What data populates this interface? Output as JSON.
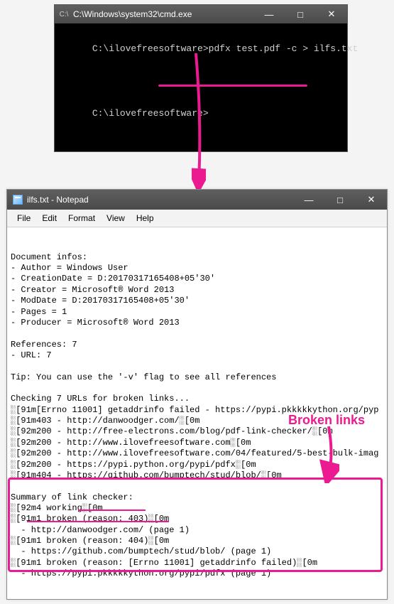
{
  "cmd": {
    "title": "C:\\Windows\\system32\\cmd.exe",
    "prompt1": "C:\\ilovefreesoftware>",
    "command": "pdfx test.pdf -c > ilfs.txt",
    "prompt2": "C:\\ilovefreesoftware>"
  },
  "notepad": {
    "title": "ilfs.txt - Notepad",
    "menu": [
      "File",
      "Edit",
      "Format",
      "View",
      "Help"
    ],
    "lines": [
      "Document infos:",
      "- Author = Windows User",
      "- CreationDate = D:20170317165408+05'30'",
      "- Creator = Microsoft® Word 2013",
      "- ModDate = D:20170317165408+05'30'",
      "- Pages = 1",
      "- Producer = Microsoft® Word 2013",
      "",
      "References: 7",
      "- URL: 7",
      "",
      "Tip: You can use the '-v' flag to see all references",
      "",
      "Checking 7 URLs for broken links...",
      "░[91m[Errno 11001] getaddrinfo failed - https://pypi.pkkkkkython.org/pyp",
      "░[91m403 - http://danwoodger.com/░[0m",
      "░[92m200 - http://free-electrons.com/blog/pdf-link-checker/░[0m",
      "░[92m200 - http://www.ilovefreesoftware.com░[0m",
      "░[92m200 - http://www.ilovefreesoftware.com/04/featured/5-best-bulk-imag",
      "░[92m200 - https://pypi.python.org/pypi/pdfx░[0m",
      "░[91m404 - https://github.com/bumptech/stud/blob/░[0m",
      "",
      "Summary of link checker:",
      "░[92m4 working░[0m",
      "░[91m1 broken (reason: 403)░[0m",
      "  - http://danwoodger.com/ (page 1)",
      "░[91m1 broken (reason: 404)░[0m",
      "  - https://github.com/bumptech/stud/blob/ (page 1)",
      "░[91m1 broken (reason: [Errno 11001] getaddrinfo failed)░[0m",
      "  - https://pypi.pkkkkkython.org/pypi/pdfx (page 1)"
    ]
  },
  "annotation": {
    "label": "Broken links"
  },
  "winControls": {
    "min": "—",
    "max": "□",
    "close": "✕"
  }
}
